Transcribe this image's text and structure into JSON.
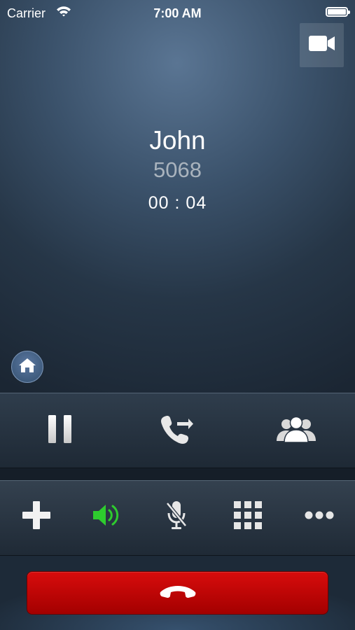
{
  "status_bar": {
    "carrier": "Carrier",
    "time": "7:00 AM"
  },
  "call": {
    "name": "John",
    "number": "5068",
    "duration": "00 : 04"
  },
  "icons": {
    "video": "video-camera-icon",
    "home": "home-icon",
    "hold": "pause-icon",
    "transfer": "call-transfer-icon",
    "conference": "conference-icon",
    "add": "plus-icon",
    "speaker": "speaker-icon",
    "mute": "microphone-muted-icon",
    "keypad": "keypad-icon",
    "more": "more-icon",
    "end_call": "hang-up-icon"
  },
  "colors": {
    "speaker_active": "#2ecc2e",
    "end_call": "#cc0000"
  }
}
